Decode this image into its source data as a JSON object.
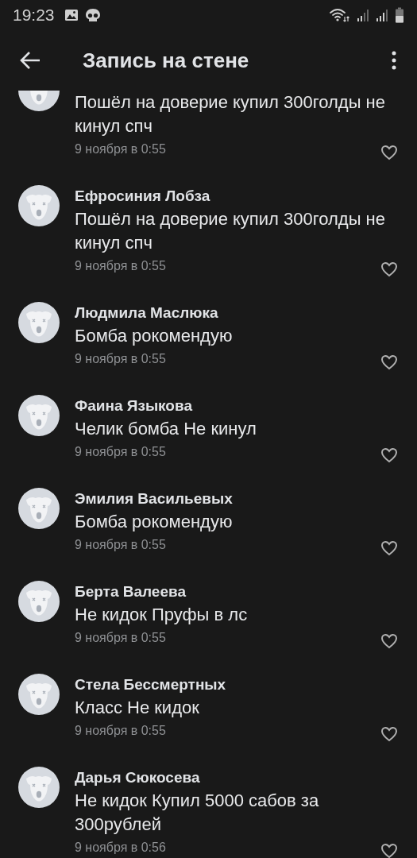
{
  "status_bar": {
    "time": "19:23"
  },
  "header": {
    "title": "Запись на стене"
  },
  "comments": [
    {
      "text": "Пошёл на доверие купил 300голды не кинул спч",
      "date": "9 ноября в 0:55",
      "liked": false
    },
    {
      "author": "Ефросиния Лобза",
      "text": "Пошёл на доверие купил 300голды не кинул спч",
      "date": "9 ноября в 0:55",
      "liked": false
    },
    {
      "author": "Людмила Маслюка",
      "text": "Бомба рокомендую",
      "date": "9 ноября в 0:55",
      "liked": false
    },
    {
      "author": "Фаина Языкова",
      "text": "Челик бомба Не кинул",
      "date": "9 ноября в 0:55",
      "liked": false
    },
    {
      "author": "Эмилия Васильевых",
      "text": "Бомба рокомендую",
      "date": "9 ноября в 0:55",
      "liked": false
    },
    {
      "author": "Берта Валеева",
      "text": "Не кидок Пруфы в лс",
      "date": "9 ноября в 0:55",
      "liked": false
    },
    {
      "author": "Стела Бессмертных",
      "text": "Класс Не кидок",
      "date": "9 ноября в 0:55",
      "liked": false
    },
    {
      "author": "Дарья Сюкосева",
      "text": "Не кидок Купил 5000 сабов за 300рублей",
      "date": "9 ноября в 0:56",
      "liked": false
    }
  ]
}
